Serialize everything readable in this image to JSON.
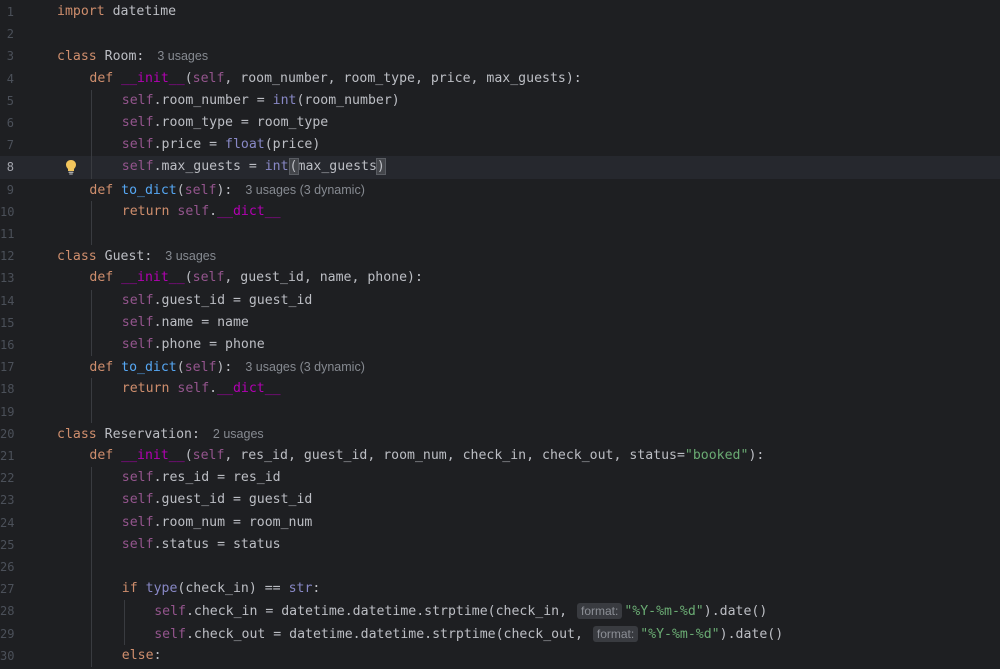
{
  "editor": {
    "current_line": 8,
    "lines": [
      {
        "n": "1",
        "indent": 0,
        "tokens": [
          {
            "t": "import",
            "c": "kw"
          },
          {
            "t": " datetime",
            "c": "plain"
          }
        ]
      },
      {
        "n": "2",
        "indent": 0,
        "tokens": []
      },
      {
        "n": "3",
        "indent": 0,
        "tokens": [
          {
            "t": "class",
            "c": "kw"
          },
          {
            "t": " Room:",
            "c": "plain"
          },
          {
            "t": "3 usages",
            "c": "hint"
          }
        ]
      },
      {
        "n": "4",
        "indent": 1,
        "tokens": [
          {
            "t": "def",
            "c": "kw"
          },
          {
            "t": " ",
            "c": "plain"
          },
          {
            "t": "__init__",
            "c": "dunder"
          },
          {
            "t": "(",
            "c": "plain"
          },
          {
            "t": "self",
            "c": "self"
          },
          {
            "t": ", room_number, room_type, price, max_guests):",
            "c": "plain"
          }
        ]
      },
      {
        "n": "5",
        "indent": 2,
        "tokens": [
          {
            "t": "self",
            "c": "self"
          },
          {
            "t": ".room_number = ",
            "c": "plain"
          },
          {
            "t": "int",
            "c": "builtin"
          },
          {
            "t": "(room_number)",
            "c": "plain"
          }
        ]
      },
      {
        "n": "6",
        "indent": 2,
        "tokens": [
          {
            "t": "self",
            "c": "self"
          },
          {
            "t": ".room_type = room_type",
            "c": "plain"
          }
        ]
      },
      {
        "n": "7",
        "indent": 2,
        "tokens": [
          {
            "t": "self",
            "c": "self"
          },
          {
            "t": ".price = ",
            "c": "plain"
          },
          {
            "t": "float",
            "c": "builtin"
          },
          {
            "t": "(price)",
            "c": "plain"
          }
        ]
      },
      {
        "n": "8",
        "indent": 2,
        "tokens": [
          {
            "t": "self",
            "c": "self"
          },
          {
            "t": ".max_guests = ",
            "c": "plain"
          },
          {
            "t": "int",
            "c": "builtin"
          },
          {
            "t": "caret",
            "c": "caret"
          },
          {
            "t": "(",
            "c": "brace"
          },
          {
            "t": "max_guests",
            "c": "plain"
          },
          {
            "t": ")",
            "c": "brace"
          }
        ]
      },
      {
        "n": "9",
        "indent": 1,
        "tokens": [
          {
            "t": "def",
            "c": "kw"
          },
          {
            "t": " ",
            "c": "plain"
          },
          {
            "t": "to_dict",
            "c": "fn"
          },
          {
            "t": "(",
            "c": "plain"
          },
          {
            "t": "self",
            "c": "self"
          },
          {
            "t": "):",
            "c": "plain"
          },
          {
            "t": "3 usages (3 dynamic)",
            "c": "hint"
          }
        ]
      },
      {
        "n": "10",
        "indent": 2,
        "tokens": [
          {
            "t": "return",
            "c": "kw"
          },
          {
            "t": " ",
            "c": "plain"
          },
          {
            "t": "self",
            "c": "self"
          },
          {
            "t": ".",
            "c": "plain"
          },
          {
            "t": "__dict__",
            "c": "dunder"
          }
        ]
      },
      {
        "n": "11",
        "indent": 0,
        "tokens": []
      },
      {
        "n": "12",
        "indent": 0,
        "tokens": [
          {
            "t": "class",
            "c": "kw"
          },
          {
            "t": " Guest:",
            "c": "plain"
          },
          {
            "t": "3 usages",
            "c": "hint"
          }
        ]
      },
      {
        "n": "13",
        "indent": 1,
        "tokens": [
          {
            "t": "def",
            "c": "kw"
          },
          {
            "t": " ",
            "c": "plain"
          },
          {
            "t": "__init__",
            "c": "dunder"
          },
          {
            "t": "(",
            "c": "plain"
          },
          {
            "t": "self",
            "c": "self"
          },
          {
            "t": ", guest_id, name, phone):",
            "c": "plain"
          }
        ]
      },
      {
        "n": "14",
        "indent": 2,
        "tokens": [
          {
            "t": "self",
            "c": "self"
          },
          {
            "t": ".guest_id = guest_id",
            "c": "plain"
          }
        ]
      },
      {
        "n": "15",
        "indent": 2,
        "tokens": [
          {
            "t": "self",
            "c": "self"
          },
          {
            "t": ".name = name",
            "c": "plain"
          }
        ]
      },
      {
        "n": "16",
        "indent": 2,
        "tokens": [
          {
            "t": "self",
            "c": "self"
          },
          {
            "t": ".phone = phone",
            "c": "plain"
          }
        ]
      },
      {
        "n": "17",
        "indent": 1,
        "tokens": [
          {
            "t": "def",
            "c": "kw"
          },
          {
            "t": " ",
            "c": "plain"
          },
          {
            "t": "to_dict",
            "c": "fn"
          },
          {
            "t": "(",
            "c": "plain"
          },
          {
            "t": "self",
            "c": "self"
          },
          {
            "t": "):",
            "c": "plain"
          },
          {
            "t": "3 usages (3 dynamic)",
            "c": "hint"
          }
        ]
      },
      {
        "n": "18",
        "indent": 2,
        "tokens": [
          {
            "t": "return",
            "c": "kw"
          },
          {
            "t": " ",
            "c": "plain"
          },
          {
            "t": "self",
            "c": "self"
          },
          {
            "t": ".",
            "c": "plain"
          },
          {
            "t": "__dict__",
            "c": "dunder"
          }
        ]
      },
      {
        "n": "19",
        "indent": 0,
        "tokens": []
      },
      {
        "n": "20",
        "indent": 0,
        "tokens": [
          {
            "t": "class",
            "c": "kw"
          },
          {
            "t": " Reservation:",
            "c": "plain"
          },
          {
            "t": "2 usages",
            "c": "hint"
          }
        ]
      },
      {
        "n": "21",
        "indent": 1,
        "tokens": [
          {
            "t": "def",
            "c": "kw"
          },
          {
            "t": " ",
            "c": "plain"
          },
          {
            "t": "__init__",
            "c": "dunder"
          },
          {
            "t": "(",
            "c": "plain"
          },
          {
            "t": "self",
            "c": "self"
          },
          {
            "t": ", res_id, guest_id, room_num, check_in, check_out, status=",
            "c": "plain"
          },
          {
            "t": "\"booked\"",
            "c": "str"
          },
          {
            "t": "):",
            "c": "plain"
          }
        ]
      },
      {
        "n": "22",
        "indent": 2,
        "tokens": [
          {
            "t": "self",
            "c": "self"
          },
          {
            "t": ".res_id = res_id",
            "c": "plain"
          }
        ]
      },
      {
        "n": "23",
        "indent": 2,
        "tokens": [
          {
            "t": "self",
            "c": "self"
          },
          {
            "t": ".guest_id = guest_id",
            "c": "plain"
          }
        ]
      },
      {
        "n": "24",
        "indent": 2,
        "tokens": [
          {
            "t": "self",
            "c": "self"
          },
          {
            "t": ".room_num = room_num",
            "c": "plain"
          }
        ]
      },
      {
        "n": "25",
        "indent": 2,
        "tokens": [
          {
            "t": "self",
            "c": "self"
          },
          {
            "t": ".status = status",
            "c": "plain"
          }
        ]
      },
      {
        "n": "26",
        "indent": 0,
        "tokens": []
      },
      {
        "n": "27",
        "indent": 2,
        "tokens": [
          {
            "t": "if",
            "c": "kw"
          },
          {
            "t": " ",
            "c": "plain"
          },
          {
            "t": "type",
            "c": "builtin"
          },
          {
            "t": "(check_in) == ",
            "c": "plain"
          },
          {
            "t": "str",
            "c": "builtin"
          },
          {
            "t": ":",
            "c": "plain"
          }
        ]
      },
      {
        "n": "28",
        "indent": 3,
        "tokens": [
          {
            "t": "self",
            "c": "self"
          },
          {
            "t": ".check_in = datetime.datetime.strptime(check_in, ",
            "c": "plain"
          },
          {
            "t": "format:",
            "c": "inlay"
          },
          {
            "t": "\"%Y-%m-%d\"",
            "c": "str"
          },
          {
            "t": ").date()",
            "c": "plain"
          }
        ]
      },
      {
        "n": "29",
        "indent": 3,
        "tokens": [
          {
            "t": "self",
            "c": "self"
          },
          {
            "t": ".check_out = datetime.datetime.strptime(check_out, ",
            "c": "plain"
          },
          {
            "t": "format:",
            "c": "inlay"
          },
          {
            "t": "\"%Y-%m-%d\"",
            "c": "str"
          },
          {
            "t": ").date()",
            "c": "plain"
          }
        ]
      },
      {
        "n": "30",
        "indent": 2,
        "tokens": [
          {
            "t": "else",
            "c": "kw"
          },
          {
            "t": ":",
            "c": "plain"
          }
        ]
      }
    ]
  },
  "colors": {
    "background": "#1e1f22",
    "keyword": "#cf8e6d",
    "self": "#94558d",
    "dunder": "#b200b2",
    "function": "#56a8f5",
    "builtin": "#8888c6",
    "string": "#6aab73",
    "text": "#bcbec4"
  },
  "icons": {
    "intention": "lightbulb-icon"
  }
}
